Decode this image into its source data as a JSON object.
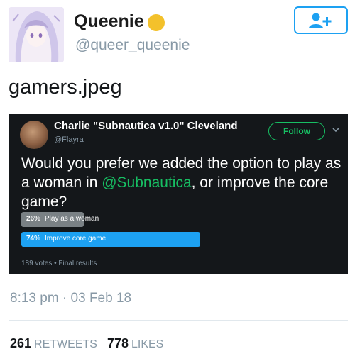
{
  "profile": {
    "display_name": "Queenie",
    "handle": "@queer_queenie"
  },
  "tweet": {
    "text": "gamers.jpeg",
    "timestamp": "8:13 pm · 03 Feb 18",
    "retweets_count": "261",
    "retweets_label": "RETWEETS",
    "likes_count": "778",
    "likes_label": "LIKES"
  },
  "embedded_tweet": {
    "name": "Charlie \"Subnautica v1.0\" Cleveland",
    "handle": "@Flayra",
    "follow_label": "Follow",
    "question_before": "Would you prefer we added the option to play as a woman in ",
    "question_mention": "@Subnautica",
    "question_after": ", or improve the core game?",
    "poll": {
      "options": [
        {
          "percent": "26%",
          "label": "Play as a woman",
          "fraction": 0.26
        },
        {
          "percent": "74%",
          "label": "Improve core game",
          "fraction": 0.74
        }
      ],
      "meta": "189 votes • Final results"
    }
  },
  "icons": {
    "follow": "add-user-icon",
    "verified": "emoji-circle-icon",
    "menu": "chevron-down-icon"
  },
  "colors": {
    "accent": "#1da1f2",
    "embed_bg": "#14171a",
    "mention": "#17bf63",
    "muted": "#8899a6",
    "bar_grey": "#7a8185"
  }
}
